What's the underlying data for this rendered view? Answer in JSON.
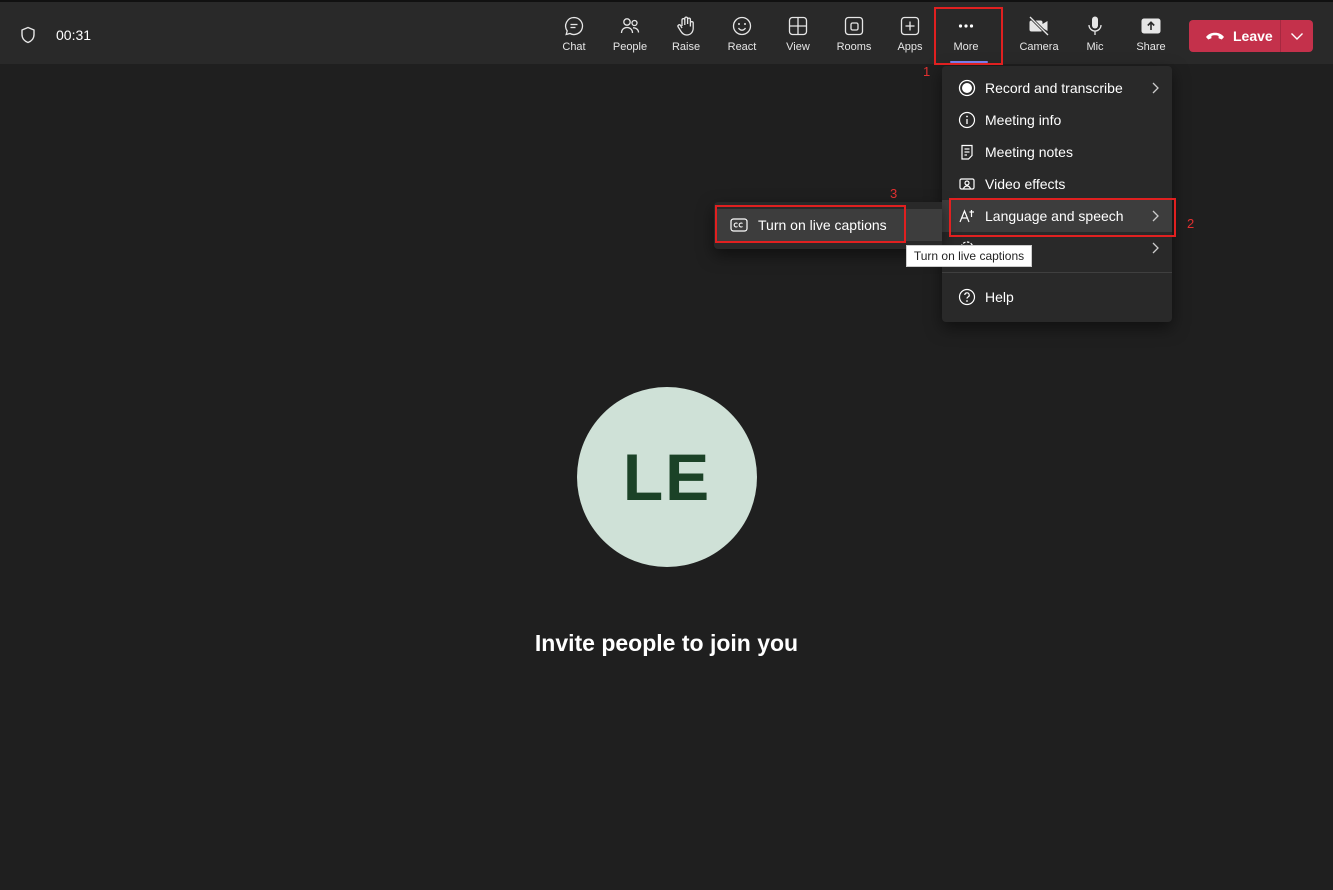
{
  "header": {
    "timer": "00:31",
    "toolbar": [
      {
        "key": "chat",
        "label": "Chat",
        "icon": "chat-icon"
      },
      {
        "key": "people",
        "label": "People",
        "icon": "people-icon"
      },
      {
        "key": "raise",
        "label": "Raise",
        "icon": "raise-hand-icon"
      },
      {
        "key": "react",
        "label": "React",
        "icon": "smiley-icon"
      },
      {
        "key": "view",
        "label": "View",
        "icon": "grid-icon"
      },
      {
        "key": "rooms",
        "label": "Rooms",
        "icon": "rooms-icon"
      },
      {
        "key": "apps",
        "label": "Apps",
        "icon": "plus-box-icon"
      },
      {
        "key": "more",
        "label": "More",
        "icon": "more-dots-icon"
      },
      {
        "key": "camera",
        "label": "Camera",
        "icon": "camera-off-icon"
      },
      {
        "key": "mic",
        "label": "Mic",
        "icon": "mic-icon"
      },
      {
        "key": "share",
        "label": "Share",
        "icon": "share-icon"
      }
    ],
    "leave_label": "Leave"
  },
  "more_menu": {
    "items": [
      {
        "label": "Record and transcribe",
        "icon": "record-icon",
        "has_submenu": true
      },
      {
        "label": "Meeting info",
        "icon": "info-icon",
        "has_submenu": false
      },
      {
        "label": "Meeting notes",
        "icon": "notes-icon",
        "has_submenu": false
      },
      {
        "label": "Video effects",
        "icon": "video-effects-icon",
        "has_submenu": false
      },
      {
        "label": "Language and speech",
        "icon": "language-icon",
        "has_submenu": true
      },
      {
        "label": "",
        "icon": "settings-icon",
        "has_submenu": true
      },
      {
        "label": "Help",
        "icon": "help-icon",
        "has_submenu": false
      }
    ]
  },
  "submenu": {
    "item_label": "Turn on live captions",
    "icon": "closed-captions-icon"
  },
  "tooltip": "Turn on live captions",
  "annotations": [
    "1",
    "2",
    "3"
  ],
  "stage": {
    "avatar_initials": "LE",
    "invite_text": "Invite people to join you"
  },
  "colors": {
    "background": "#1f1f1f",
    "leave_button": "#c4314b",
    "avatar_bg": "#cfe1d7",
    "avatar_text": "#1b4227",
    "annotation_red": "#e02020",
    "accent_underline": "#7f85f5"
  }
}
